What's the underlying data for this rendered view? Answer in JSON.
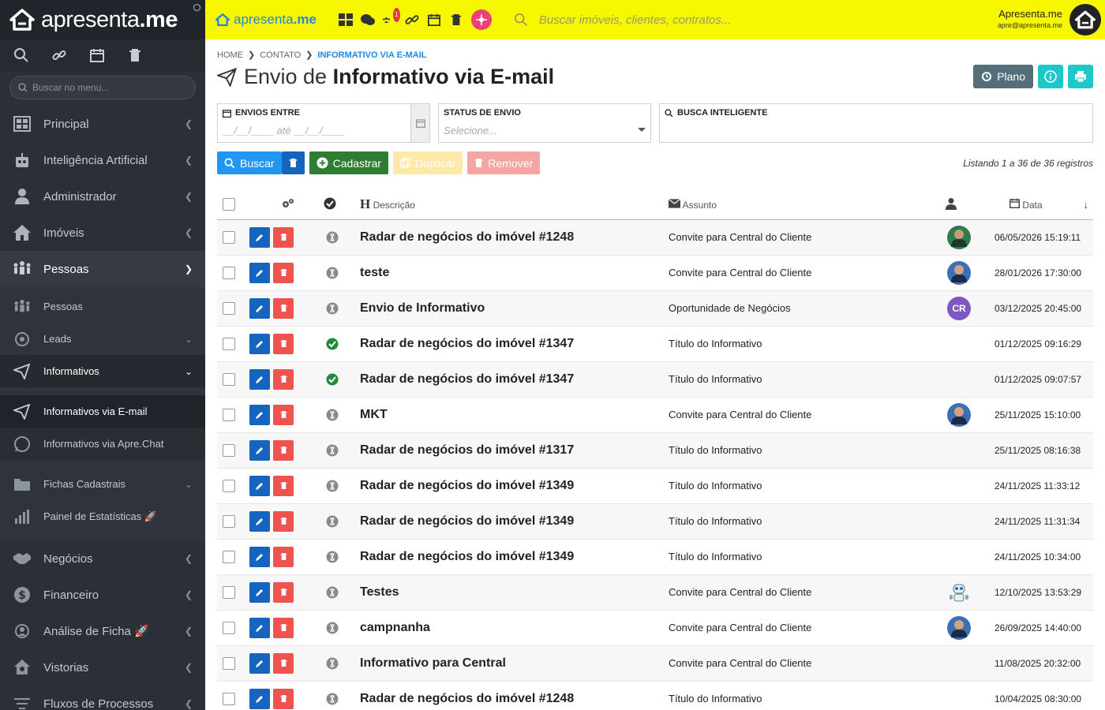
{
  "app": {
    "logo_text_light": "apresenta",
    "logo_text_bold": ".me"
  },
  "sidebar": {
    "search_placeholder": "Buscar no menu...",
    "items": [
      {
        "label": "Principal"
      },
      {
        "label": "Inteligência Artificial"
      },
      {
        "label": "Administrador"
      },
      {
        "label": "Imóveis"
      },
      {
        "label": "Pessoas"
      }
    ],
    "sub_items": [
      {
        "label": "Pessoas"
      },
      {
        "label": "Leads"
      },
      {
        "label": "Informativos"
      },
      {
        "label": "Informativos via E-mail"
      },
      {
        "label": "Informativos via Apre.Chat"
      },
      {
        "label": "Fichas Cadastrais"
      },
      {
        "label": "Painel de Estatísticas 🚀"
      }
    ],
    "items_after": [
      {
        "label": "Negócios"
      },
      {
        "label": "Financeiro"
      },
      {
        "label": "Análise de Ficha 🚀"
      },
      {
        "label": "Vistorias"
      },
      {
        "label": "Fluxos de Processos"
      }
    ]
  },
  "topbar": {
    "logo_light": "apresenta",
    "logo_bold": ".me",
    "badge": "1",
    "search_placeholder": "Buscar imóveis, clientes, contratos...",
    "user_name": "Apresenta.me",
    "user_email": "apre@apresenta.me"
  },
  "breadcrumb": {
    "home": "HOME",
    "contato": "CONTATO",
    "current": "INFORMATIVO VIA E-MAIL"
  },
  "page": {
    "title_light": "Envio de ",
    "title_bold": "Informativo via E-mail",
    "plano_label": "Plano"
  },
  "filters": {
    "envios_label": "ENVIOS ENTRE",
    "envios_value": "__/__/____ até __/__/____",
    "status_label": "STATUS DE ENVIO",
    "status_placeholder": "Selecione...",
    "busca_label": "BUSCA INTELIGENTE"
  },
  "actions": {
    "buscar": "Buscar",
    "cadastrar": "Cadastrar",
    "duplicar": "Duplicar",
    "remover": "Remover",
    "listing": "Listando 1 a 36 de 36 registros"
  },
  "table": {
    "headers": {
      "descricao": "Descrição",
      "assunto": "Assunto",
      "data": "Data"
    },
    "rows": [
      {
        "status": "pending",
        "descricao": "Radar de negócios do imóvel #1248",
        "assunto": "Convite para Central do Cliente",
        "avatar": "photo-green",
        "data": "06/05/2026 15:19:11"
      },
      {
        "status": "pending",
        "descricao": "teste",
        "assunto": "Convite para Central do Cliente",
        "avatar": "photo-blue",
        "data": "28/01/2026 17:30:00"
      },
      {
        "status": "pending",
        "descricao": "Envio de Informativo",
        "assunto": "Oportunidade de Negócios",
        "avatar": "CR",
        "data": "03/12/2025 20:45:00"
      },
      {
        "status": "sent",
        "descricao": "Radar de negócios do imóvel #1347",
        "assunto": "Título do Informativo",
        "avatar": "",
        "data": "01/12/2025 09:16:29"
      },
      {
        "status": "sent",
        "descricao": "Radar de negócios do imóvel #1347",
        "assunto": "Título do Informativo",
        "avatar": "",
        "data": "01/12/2025 09:07:57"
      },
      {
        "status": "pending",
        "descricao": "MKT",
        "assunto": "Convite para Central do Cliente",
        "avatar": "photo-blue",
        "data": "25/11/2025 15:10:00"
      },
      {
        "status": "pending",
        "descricao": "Radar de negócios do imóvel #1317",
        "assunto": "Título do Informativo",
        "avatar": "",
        "data": "25/11/2025 08:16:38"
      },
      {
        "status": "pending",
        "descricao": "Radar de negócios do imóvel #1349",
        "assunto": "Título do Informativo",
        "avatar": "",
        "data": "24/11/2025 11:33:12"
      },
      {
        "status": "pending",
        "descricao": "Radar de negócios do imóvel #1349",
        "assunto": "Título do Informativo",
        "avatar": "",
        "data": "24/11/2025 11:31:34"
      },
      {
        "status": "pending",
        "descricao": "Radar de negócios do imóvel #1349",
        "assunto": "Título do Informativo",
        "avatar": "",
        "data": "24/11/2025 10:34:00"
      },
      {
        "status": "pending",
        "descricao": "Testes",
        "assunto": "Convite para Central do Cliente",
        "avatar": "robot",
        "data": "12/10/2025 13:53:29"
      },
      {
        "status": "pending",
        "descricao": "campnanha",
        "assunto": "Convite para Central do Cliente",
        "avatar": "photo-blue",
        "data": "26/09/2025 14:40:00"
      },
      {
        "status": "pending",
        "descricao": "Informativo para Central",
        "assunto": "Convite para Central do Cliente",
        "avatar": "",
        "data": "11/08/2025 20:32:00"
      },
      {
        "status": "pending",
        "descricao": "Radar de negócios do imóvel #1248",
        "assunto": "Título do Informativo",
        "avatar": "",
        "data": "10/04/2025 08:30:00"
      }
    ]
  }
}
